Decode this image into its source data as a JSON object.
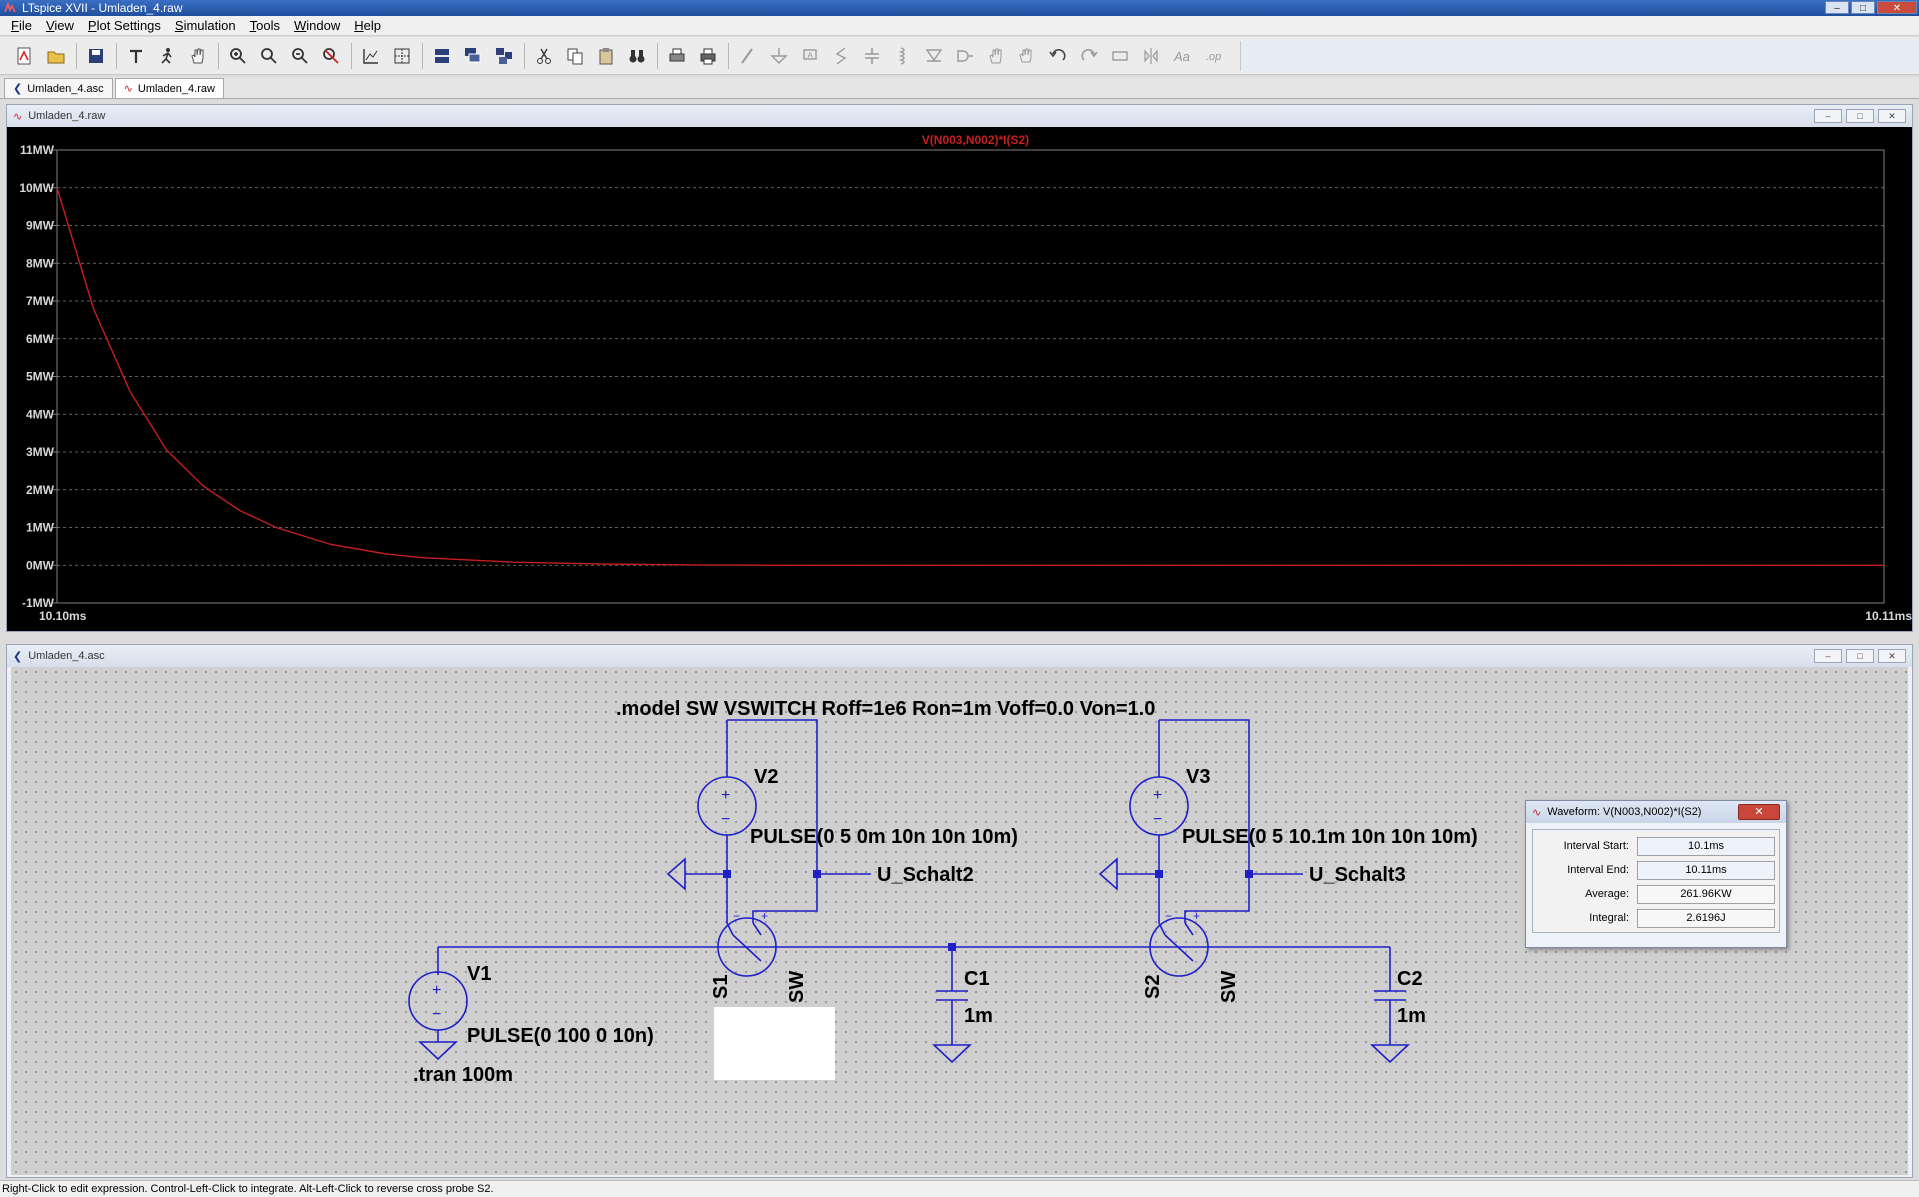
{
  "window": {
    "title": "LTspice XVII - Umladen_4.raw",
    "controls": [
      "–",
      "□",
      "✕"
    ]
  },
  "menu": [
    {
      "key": "F",
      "rest": "ile"
    },
    {
      "key": "V",
      "rest": "iew"
    },
    {
      "key": "P",
      "rest": "lot Settings"
    },
    {
      "key": "S",
      "rest": "imulation"
    },
    {
      "key": "T",
      "rest": "ools"
    },
    {
      "key": "W",
      "rest": "indow"
    },
    {
      "key": "H",
      "rest": "elp"
    }
  ],
  "tabs": [
    {
      "label": "Umladen_4.asc",
      "icon": "schematic-icon"
    },
    {
      "label": "Umladen_4.raw",
      "icon": "waveform-icon"
    }
  ],
  "plot_window": {
    "title": "Umladen_4.raw",
    "controls": [
      "–",
      "□",
      "✕"
    ]
  },
  "chart_data": {
    "type": "line",
    "title": "",
    "xlabel": "",
    "ylabel": "",
    "x_unit": "ms",
    "y_unit": "MW",
    "xlim": [
      10.1,
      10.11
    ],
    "ylim": [
      -1,
      11
    ],
    "x_tick_labels": [
      "10.10ms",
      "10.11ms"
    ],
    "y_ticks": [
      11,
      10,
      9,
      8,
      7,
      6,
      5,
      4,
      3,
      2,
      1,
      0,
      -1
    ],
    "y_tick_labels": [
      "11MW",
      "10MW",
      "9MW",
      "8MW",
      "7MW",
      "6MW",
      "5MW",
      "4MW",
      "3MW",
      "2MW",
      "1MW",
      "0MW",
      "-1MW"
    ],
    "grid": true,
    "background": "#000000",
    "grid_color": "#808080",
    "series": [
      {
        "name": "V(N003,N002)*I(S2)",
        "color": "#c81e1e",
        "x": [
          10.1,
          10.1002,
          10.1004,
          10.1006,
          10.1008,
          10.101,
          10.1012,
          10.1015,
          10.1018,
          10.102,
          10.1025,
          10.103,
          10.1035,
          10.104,
          10.105,
          10.106,
          10.107,
          10.108,
          10.109,
          10.11
        ],
        "y": [
          10.0,
          6.8,
          4.6,
          3.05,
          2.1,
          1.45,
          1.0,
          0.55,
          0.3,
          0.2,
          0.08,
          0.03,
          0.01,
          0.0,
          0.0,
          0.0,
          0.0,
          0.0,
          0.0,
          0.0
        ]
      }
    ]
  },
  "schematic_window": {
    "title": "Umladen_4.asc",
    "controls": [
      "–",
      "□",
      "✕"
    ],
    "model_directive": ".model SW VSWITCH Roff=1e6 Ron=1m Voff=0.0 Von=1.0",
    "tran_directive": ".tran 100m",
    "components": {
      "v1_name": "V1",
      "v1_value": "PULSE(0 100 0 10n)",
      "v2_name": "V2",
      "v2_value": "PULSE(0 5 0m 10n 10n 10m)",
      "v3_name": "V3",
      "v3_value": "PULSE(0 5 10.1m 10n 10n 10m)",
      "s1_name": "S1",
      "s1_model": "SW",
      "s2_name": "S2",
      "s2_model": "SW",
      "c1_name": "C1",
      "c1_value": "1m",
      "c2_name": "C2",
      "c2_value": "1m",
      "label_u2": "U_Schalt2",
      "label_u3": "U_Schalt3",
      "plus": "+",
      "minus": "−"
    },
    "wire_color": "#1f1fc8"
  },
  "waveform_dialog": {
    "title": "Waveform: V(N003,N002)*I(S2)",
    "close": "✕",
    "rows": [
      {
        "label": "Interval Start:",
        "value": "10.1ms"
      },
      {
        "label": "Interval End:",
        "value": "10.11ms"
      },
      {
        "label": "Average:",
        "value": "261.96KW"
      },
      {
        "label": "Integral:",
        "value": "2.6196J"
      }
    ]
  },
  "status_bar": {
    "text": "Right-Click to edit expression. Control-Left-Click to integrate. Alt-Left-Click to reverse cross probe S2."
  }
}
